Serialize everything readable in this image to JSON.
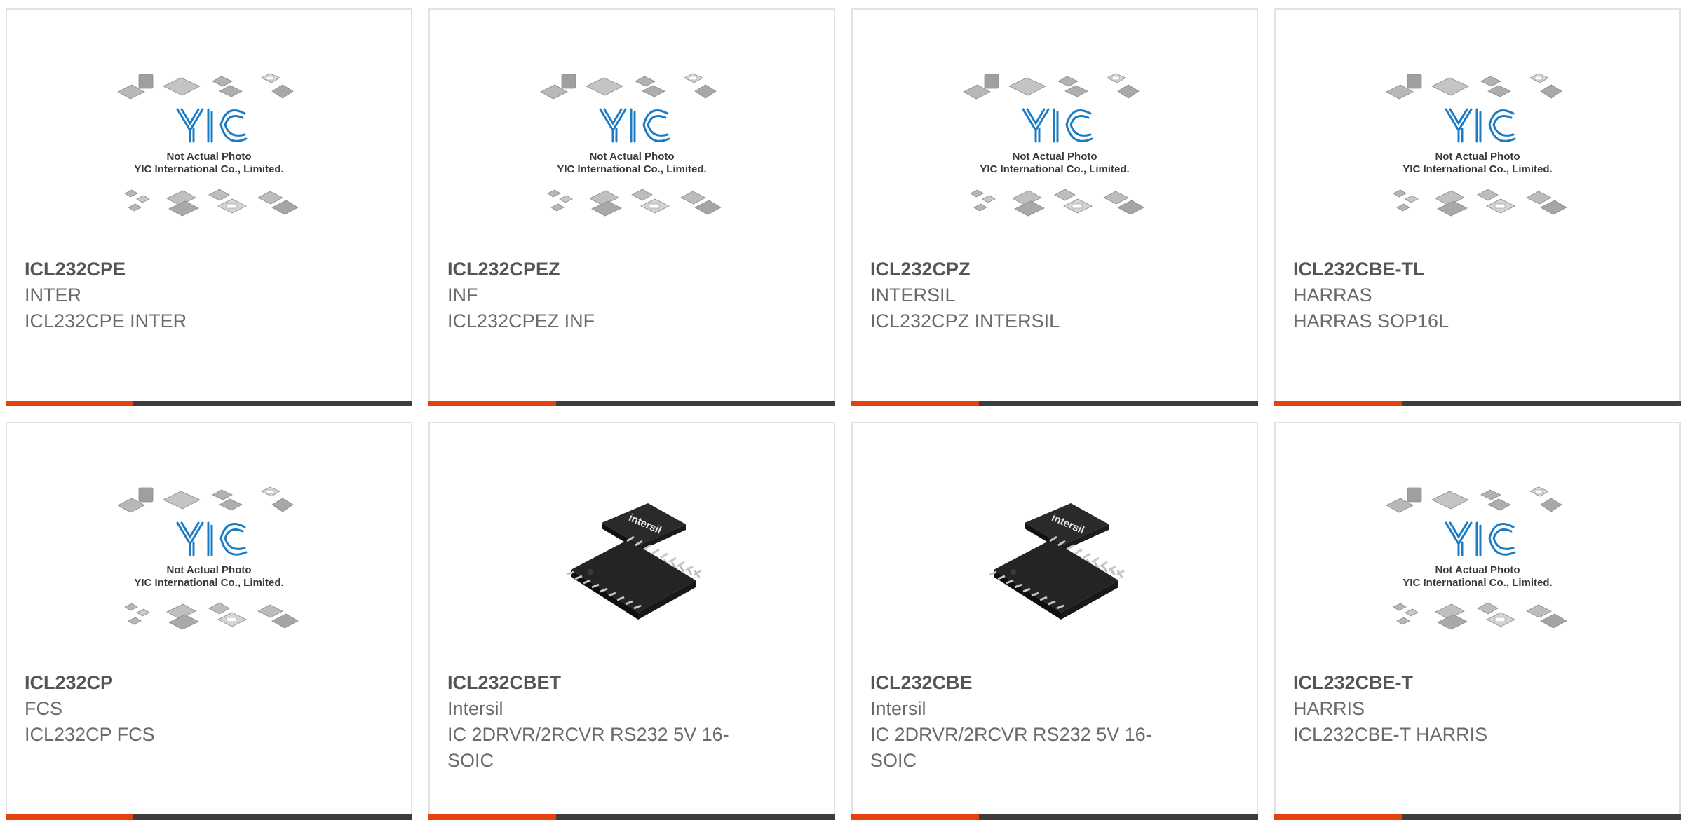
{
  "colors": {
    "accent": "#e5410f",
    "bar": "#3d3d3d",
    "logo_blue": "#1a7cc4",
    "text": "#6a6a6a"
  },
  "placeholder": {
    "icon": "yic-placeholder-image",
    "line1": "Not Actual Photo",
    "line2": "YIC International Co., Limited."
  },
  "products": [
    {
      "part_number": "ICL232CPE",
      "manufacturer": "INTER",
      "description": "ICL232CPE INTER",
      "image": "yic-placeholder"
    },
    {
      "part_number": "ICL232CPEZ",
      "manufacturer": "INF",
      "description": "ICL232CPEZ INF",
      "image": "yic-placeholder"
    },
    {
      "part_number": "ICL232CPZ",
      "manufacturer": "INTERSIL",
      "description": "ICL232CPZ INTERSIL",
      "image": "yic-placeholder"
    },
    {
      "part_number": "ICL232CBE-TL",
      "manufacturer": "HARRAS",
      "description": "HARRAS SOP16L",
      "image": "yic-placeholder"
    },
    {
      "part_number": "ICL232CP",
      "manufacturer": "FCS",
      "description": "ICL232CP FCS",
      "image": "yic-placeholder"
    },
    {
      "part_number": "ICL232CBET",
      "manufacturer": "Intersil",
      "description": "IC 2DRVR/2RCVR RS232 5V 16-SOIC",
      "image": "soic-chip-photo",
      "chip_marking": "intersil"
    },
    {
      "part_number": "ICL232CBE",
      "manufacturer": "Intersil",
      "description": "IC 2DRVR/2RCVR RS232 5V 16-SOIC",
      "image": "soic-chip-photo",
      "chip_marking": "intersil"
    },
    {
      "part_number": "ICL232CBE-T",
      "manufacturer": "HARRIS",
      "description": "ICL232CBE-T HARRIS",
      "image": "yic-placeholder"
    }
  ]
}
